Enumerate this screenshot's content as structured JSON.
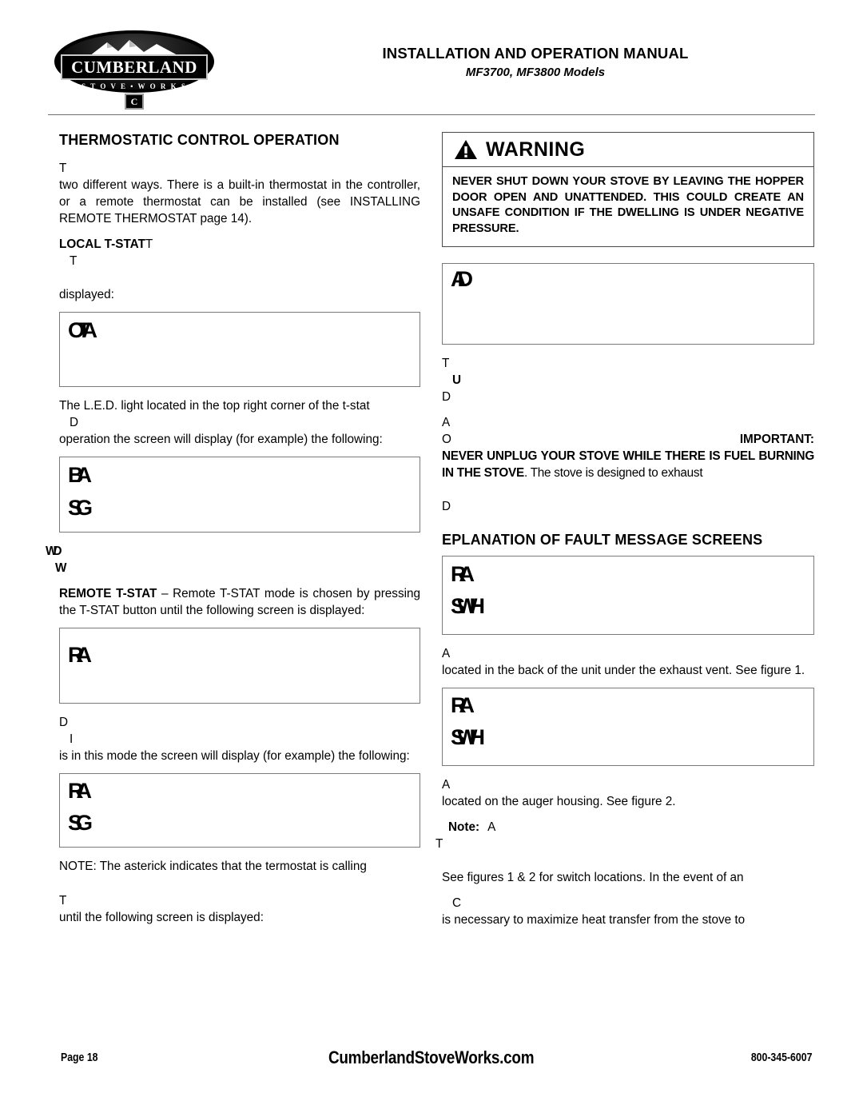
{
  "header": {
    "logo": {
      "brand": "CUMBERLAND",
      "tagline": "S T O V E  •  W O R K S",
      "badge": "C"
    },
    "title": "INSTALLATION AND OPERATION MANUAL",
    "subtitle": "MF3700, MF3800 Models"
  },
  "left_column": {
    "section_heading": "THERMOSTATIC CONTROL OPERATION",
    "fragment_1": "T",
    "intro_paragraph": "two different ways.  There is a built-in thermostat in the controller, or a remote thermostat can be installed (see INSTALLING REMOTE THERMOSTAT page 14).",
    "local_tstat_label": "LOCAL T-STAT",
    "local_tstat_trailing": "T",
    "fragment_2": "T",
    "displayed_label": "displayed:",
    "lcd_1": {
      "line1": "OTA",
      "line2": ""
    },
    "led_paragraph_line1": "The L.E.D. light located in the top right corner of the t-stat",
    "fragment_3": "D",
    "operation_paragraph": "operation the screen will display (for example) the following:",
    "lcd_2": {
      "line1": "BA",
      "line2": "SG"
    },
    "fragment_4": "WD",
    "fragment_5": "W",
    "remote_tstat_label": "REMOTE T-STAT",
    "remote_tstat_paragraph": " – Remote T-STAT mode is chosen by pressing the T-STAT button until the following screen is displayed:",
    "lcd_3": {
      "line1": "RA",
      "line2": ""
    },
    "fragment_6": "D",
    "fragment_7": "I",
    "mode_paragraph": "is in this mode the screen will display (for example) the following:",
    "lcd_4": {
      "line1": "RA",
      "line2": "SG"
    },
    "note_paragraph": "NOTE: The asterick indicates that the termostat is calling",
    "fragment_8": "T",
    "until_paragraph": "until the following screen is displayed:"
  },
  "right_column": {
    "warning": {
      "icon": "warning-triangle-icon",
      "title": "WARNING",
      "body": "NEVER SHUT DOWN YOUR STOVE BY LEAVING THE HOPPER DOOR OPEN AND UNATTENDED.  THIS COULD CREATE AN UNSAFE CONDITION IF THE DWELLING IS UNDER NEGATIVE PRESSURE."
    },
    "lcd_5": {
      "line1": "AD",
      "line2": ""
    },
    "fragment_1": "T",
    "fragment_2": "U",
    "fragment_3": "D",
    "fragment_4": "A",
    "fragment_5": "O",
    "important_label": "IMPORTANT:",
    "important_bold": "NEVER UNPLUG YOUR STOVE WHILE THERE IS FUEL BURNING IN THE STOVE",
    "important_rest": ". The stove is designed to exhaust",
    "fragment_6": "D",
    "fault_heading": "EPLANATION OF FAULT MESSAGE SCREENS",
    "lcd_6": {
      "line1": "RA",
      "line2": "SWH"
    },
    "fragment_7": "A",
    "back_paragraph": "located in the back of the unit under the exhaust vent.  See figure 1.",
    "lcd_7": {
      "line1": "RA",
      "line2": "SWH"
    },
    "fragment_8": "A",
    "auger_paragraph": "located on the auger housing.  See figure 2.",
    "note_label": "Note:",
    "note_fragment": "A",
    "fragment_9": "T",
    "switch_paragraph": "See figures 1 & 2 for switch locations. In the event of an",
    "fragment_10": "C",
    "heat_paragraph": "is necessary to maximize heat transfer from the stove to"
  },
  "footer": {
    "page_label": "Page 18",
    "website": "CumberlandStoveWorks.com",
    "phone": "800-345-6007"
  }
}
